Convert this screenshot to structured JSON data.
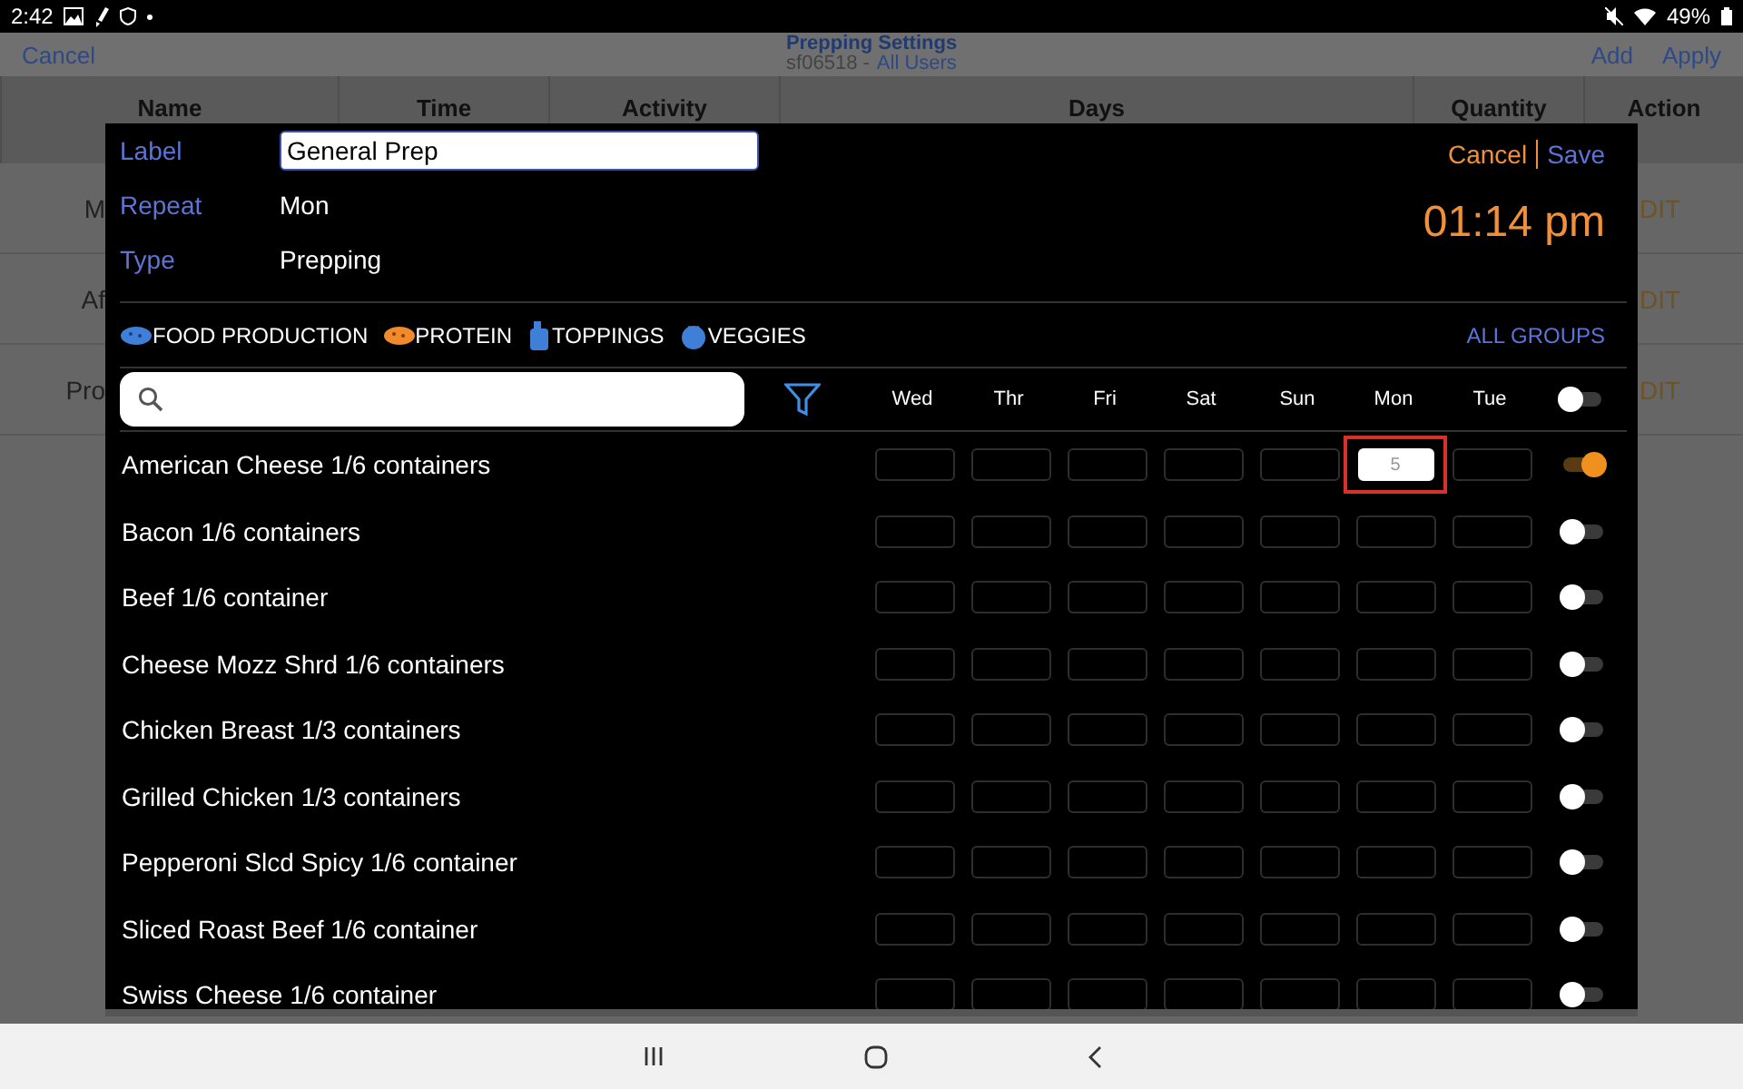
{
  "status_bar": {
    "time": "2:42",
    "battery": "49%"
  },
  "background": {
    "header": {
      "left_action": "Cancel",
      "title": "Prepping Settings",
      "subtitle": "sf06518 -",
      "subtitle_link": "All Users",
      "actions": [
        "Add",
        "Apply"
      ]
    },
    "table": {
      "columns": [
        "Name",
        "Time",
        "Activity",
        "Days",
        "Quantity",
        "Action"
      ],
      "rows": [
        {
          "name": "M",
          "action": "DIT"
        },
        {
          "name": "Af",
          "action": "DIT"
        },
        {
          "name": "Pro",
          "action": "DIT"
        }
      ]
    }
  },
  "dialog": {
    "label": {
      "caption": "Label",
      "value": "General Prep"
    },
    "repeat": {
      "caption": "Repeat",
      "value": "Mon"
    },
    "type": {
      "caption": "Type",
      "value": "Prepping"
    },
    "cancel": "Cancel",
    "save": "Save",
    "time": "01:14 pm",
    "groups": [
      {
        "name": "FOOD PRODUCTION",
        "kind": "food"
      },
      {
        "name": "PROTEIN",
        "kind": "protein"
      },
      {
        "name": "TOPPINGS",
        "kind": "bottle"
      },
      {
        "name": "VEGGIES",
        "kind": "tomato"
      }
    ],
    "all_groups": "ALL GROUPS",
    "days": [
      "Wed",
      "Thr",
      "Fri",
      "Sat",
      "Sun",
      "Mon",
      "Tue"
    ],
    "all_on": false,
    "items": [
      {
        "name": "American Cheese 1/6 containers",
        "on": true,
        "cells": [
          {
            "filled": false,
            "highlighted": false
          },
          {
            "filled": false,
            "highlighted": false
          },
          {
            "filled": false,
            "highlighted": false
          },
          {
            "filled": false,
            "highlighted": false
          },
          {
            "filled": false,
            "highlighted": false
          },
          {
            "value": "5",
            "filled": true,
            "highlighted": true
          },
          {
            "filled": false,
            "highlighted": false
          }
        ]
      },
      {
        "name": "Bacon 1/6 containers",
        "on": false
      },
      {
        "name": "Beef 1/6 container",
        "on": false
      },
      {
        "name": "Cheese Mozz Shrd 1/6 containers",
        "on": false
      },
      {
        "name": "Chicken Breast 1/3 containers",
        "on": false
      },
      {
        "name": "Grilled Chicken 1/3 containers",
        "on": false
      },
      {
        "name": "Pepperoni Slcd Spicy 1/6 container",
        "on": false
      },
      {
        "name": "Sliced Roast Beef 1/6 container",
        "on": false
      },
      {
        "name": "Swiss Cheese 1/6 container",
        "on": false
      }
    ]
  }
}
